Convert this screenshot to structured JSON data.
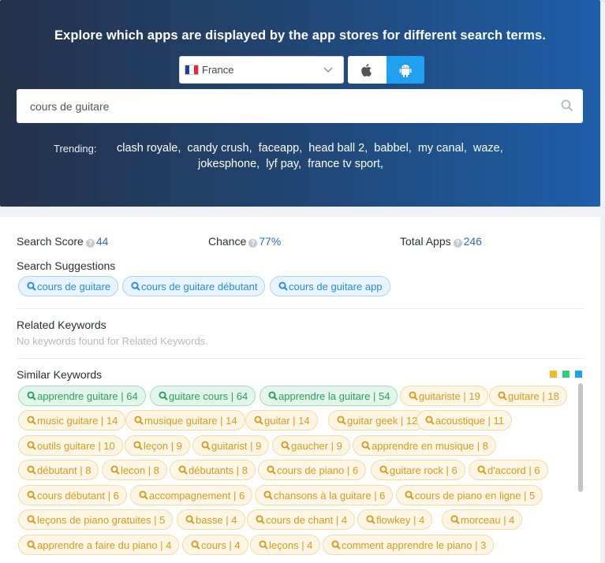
{
  "hero": {
    "title": "Explore which apps are displayed by the app stores for different search terms.",
    "country": "France",
    "search_value": "cours de guitare",
    "search_placeholder": "",
    "trending_label": "Trending:",
    "trending_line1": [
      "clash royale,",
      "candy crush,",
      "faceapp,",
      "head ball 2,",
      "babbel,",
      "my canal,",
      "waze,"
    ],
    "trending_line2": [
      "jokesphone,",
      "lyf pay,",
      "france tv sport,"
    ]
  },
  "stats": {
    "search_score_label": "Search Score",
    "search_score_value": "44",
    "chance_label": "Chance",
    "chance_value": "77%",
    "total_apps_label": "Total Apps",
    "total_apps_value": "246"
  },
  "suggestions": {
    "title": "Search Suggestions",
    "items": [
      "cours de guitare",
      "cours de guitare débutant",
      "cours de guitare app"
    ]
  },
  "related": {
    "title": "Related Keywords",
    "empty_text": "No keywords found for Related Keywords."
  },
  "similar": {
    "title": "Similar Keywords",
    "legend_colors": [
      "#f5b82a",
      "#2fcf78",
      "#1fa0f0"
    ],
    "rows": [
      [
        [
          "apprendre guitare | 64",
          "green"
        ],
        [
          "guitare cours | 64",
          "green"
        ],
        [
          "apprendre la guitare | 54",
          "green"
        ],
        [
          "guitariste | 19",
          "orange"
        ],
        [
          "guitare | 18",
          "orange"
        ]
      ],
      [
        [
          "music guitare | 14",
          "orange"
        ],
        [
          "musique guitare | 14",
          "orange"
        ],
        [
          "guitar | 14",
          "orange"
        ],
        [
          "guitar geek | 12",
          "orange"
        ],
        [
          "acoustique | 11",
          "orange"
        ]
      ],
      [
        [
          "outils guitare | 10",
          "orange"
        ],
        [
          "leçon | 9",
          "orange"
        ],
        [
          "guitarist | 9",
          "orange"
        ],
        [
          "gaucher | 9",
          "orange"
        ],
        [
          "apprendre en musique | 8",
          "orange"
        ]
      ],
      [
        [
          "débutant | 8",
          "orange"
        ],
        [
          "lecon | 8",
          "orange"
        ],
        [
          "débutants | 8",
          "orange"
        ],
        [
          "cours de piano | 6",
          "orange"
        ],
        [
          "guitare rock | 6",
          "orange"
        ],
        [
          "d'accord | 6",
          "orange"
        ]
      ],
      [
        [
          "cours débutant | 6",
          "orange"
        ],
        [
          "accompagnement | 6",
          "orange"
        ],
        [
          "chansons à la guitare | 6",
          "orange"
        ],
        [
          "cours de piano en ligne | 5",
          "orange"
        ]
      ],
      [
        [
          "leçons de piano gratuites | 5",
          "orange"
        ],
        [
          "basse | 4",
          "orange"
        ],
        [
          "cours de chant | 4",
          "orange"
        ],
        [
          "flowkey | 4",
          "orange"
        ],
        [
          "morceau | 4",
          "orange"
        ]
      ],
      [
        [
          "apprendre a faire du piano | 4",
          "orange"
        ],
        [
          "cours | 4",
          "orange"
        ],
        [
          "leçons | 4",
          "orange"
        ],
        [
          "comment apprendre le piano | 3",
          "orange"
        ]
      ]
    ]
  }
}
